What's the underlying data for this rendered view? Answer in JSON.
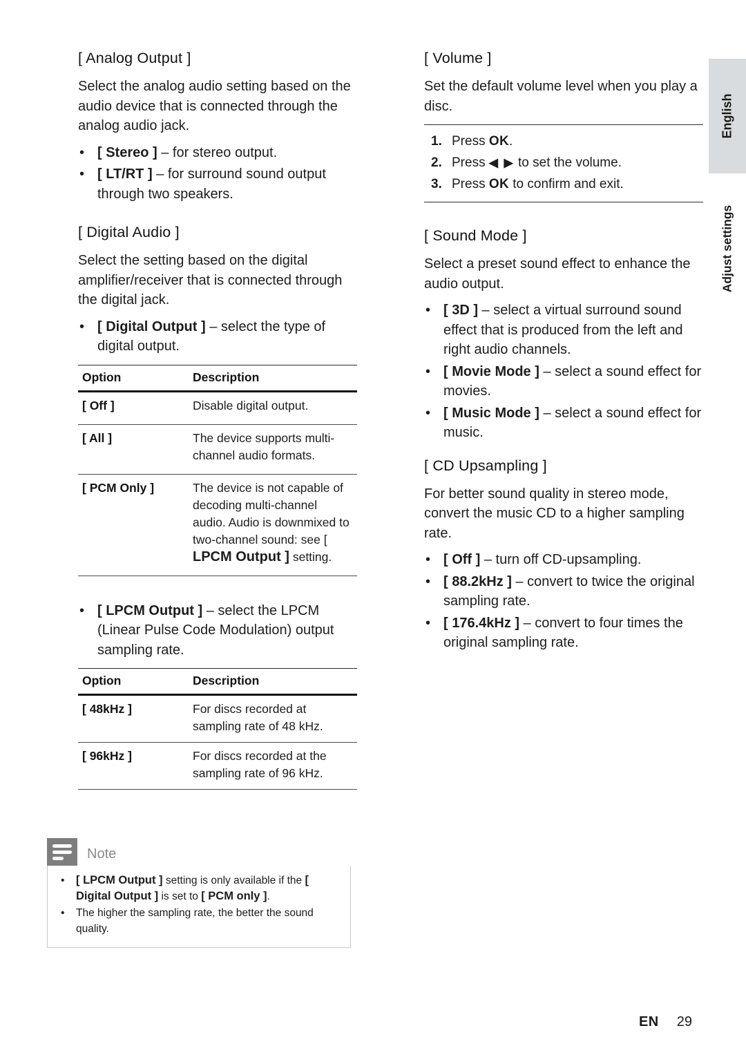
{
  "document": {
    "language_tab": "English",
    "chapter_tab": "Adjust settings",
    "footer": {
      "lang_code": "EN",
      "page_number": "29"
    }
  },
  "left_column": {
    "analog_output": {
      "heading": "[ Analog Output ]",
      "intro": "Select the analog audio setting based on the audio device that is connected through the analog audio jack.",
      "bullets": [
        {
          "term": "[ Stereo ]",
          "rest": " – for stereo output."
        },
        {
          "term": "[ LT/RT ]",
          "rest": " – for surround sound output through two speakers."
        }
      ]
    },
    "digital_audio": {
      "heading": "[ Digital Audio ]",
      "intro": "Select the setting based on the digital amplifier/receiver that is connected through the digital jack.",
      "bullet_digital_output": {
        "term": "[ Digital Output ]",
        "rest": " – select the type of digital output."
      },
      "table_digital_output": {
        "headers": [
          "Option",
          "Description"
        ],
        "rows": [
          {
            "option": "[ Off ]",
            "description": "Disable digital output."
          },
          {
            "option": "[ All ]",
            "description": "The device supports multi-channel audio formats."
          },
          {
            "option": "[ PCM Only ]",
            "description_pre": "The device is not capable of decoding multi-channel audio. Audio is downmixed to two-channel sound: see [ ",
            "description_emph": "LPCM Output ]",
            "description_post": " setting."
          }
        ]
      },
      "bullet_lpcm_output": {
        "term": "[ LPCM Output ]",
        "rest": " – select the LPCM (Linear Pulse Code Modulation) output sampling rate."
      },
      "table_lpcm_output": {
        "headers": [
          "Option",
          "Description"
        ],
        "rows": [
          {
            "option": "[ 48kHz ]",
            "description": "For discs recorded at sampling rate of 48 kHz."
          },
          {
            "option": "[ 96kHz ]",
            "description": "For discs recorded at the sampling rate of 96 kHz."
          }
        ]
      }
    },
    "note": {
      "icon": "note-lines-icon",
      "title": "Note",
      "items": [
        {
          "pre": "",
          "emph1": "[ LPCM Output ]",
          "mid1": " setting is only available if the ",
          "emph2": "[ Digital Output ]",
          "mid2": " is set to ",
          "emph3": "[ PCM only ]",
          "post": "."
        },
        {
          "plain": "The higher the sampling rate, the better the sound quality."
        }
      ]
    }
  },
  "right_column": {
    "volume": {
      "heading": "[ Volume ]",
      "intro": "Set the default volume level when you play a disc.",
      "steps": [
        {
          "num": "1.",
          "pre": "Press ",
          "key": "OK",
          "post": "."
        },
        {
          "num": "2.",
          "pre": "Press ",
          "key": "◀ ▶",
          "post": " to set the volume."
        },
        {
          "num": "3.",
          "pre": "Press ",
          "key": "OK",
          "post": " to confirm and exit."
        }
      ]
    },
    "sound_mode": {
      "heading": "[ Sound Mode ]",
      "intro": "Select a preset sound effect to enhance the audio output.",
      "bullets": [
        {
          "term": "[ 3D ]",
          "rest": " – select a virtual surround sound effect that is produced from the left and right audio channels."
        },
        {
          "term": "[ Movie Mode ]",
          "rest": " – select a sound effect for movies."
        },
        {
          "term": "[ Music Mode ]",
          "rest": " – select a sound effect for music."
        }
      ]
    },
    "cd_upsampling": {
      "heading": "[ CD Upsampling ]",
      "intro": "For better sound quality in stereo mode, convert the music CD to a higher sampling rate.",
      "bullets": [
        {
          "term": "[ Off ]",
          "rest": " – turn off CD-upsampling."
        },
        {
          "term": "[ 88.2kHz ]",
          "rest": " – convert to twice the original sampling rate."
        },
        {
          "term": "[ 176.4kHz ]",
          "rest": " – convert to four times the original sampling rate."
        }
      ]
    }
  },
  "colors": {
    "note_icon_bg": "#7e7e7e",
    "note_title": "#8a8a8a",
    "lang_tab_bg": "#d9dcde",
    "text": "#1d1d1d"
  }
}
